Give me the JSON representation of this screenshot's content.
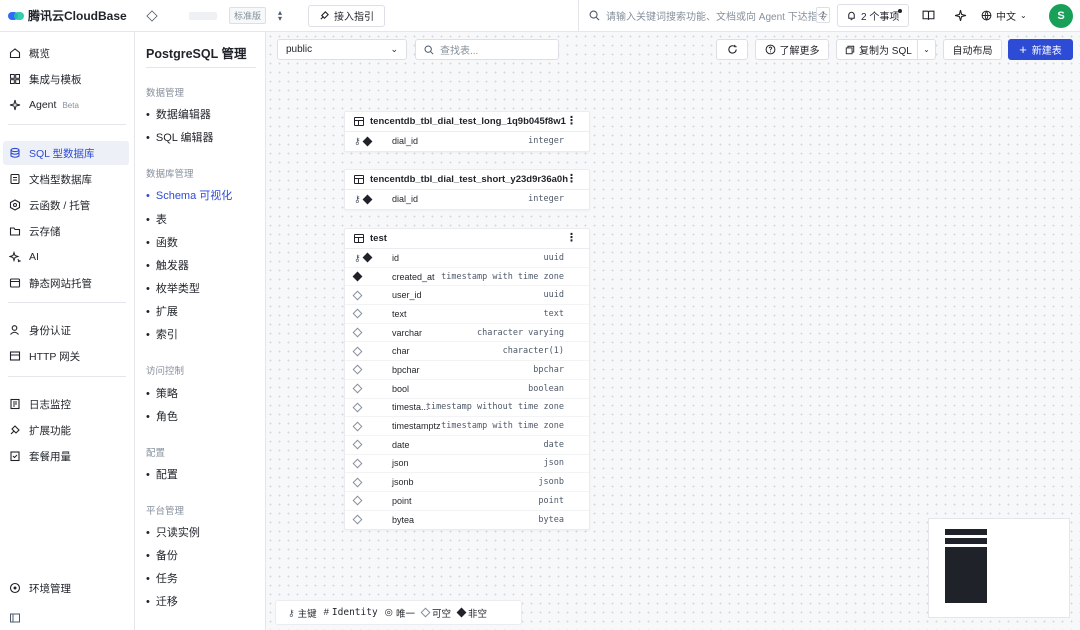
{
  "topbar": {
    "logo_text": "腾讯云CloudBase",
    "edition": "标准版",
    "guide_label": "接入指引",
    "search_placeholder": "请输入关键词搜索功能、文档或向 Agent 下达指令",
    "search_shortcut": "/",
    "todo_label": "2 个事项",
    "language": "中文",
    "avatar_letter": "S"
  },
  "leftnav": {
    "items": [
      {
        "label": "概览",
        "icon": "home-icon"
      },
      {
        "label": "集成与模板",
        "icon": "grid-icon"
      },
      {
        "label": "Agent",
        "icon": "sparkle-icon",
        "badge": "Beta"
      },
      {
        "label": "SQL 型数据库",
        "icon": "database-icon",
        "active": true
      },
      {
        "label": "文档型数据库",
        "icon": "document-db-icon"
      },
      {
        "label": "云函数 / 托管",
        "icon": "function-icon"
      },
      {
        "label": "云存储",
        "icon": "folder-icon"
      },
      {
        "label": "AI",
        "icon": "ai-icon"
      },
      {
        "label": "静态网站托管",
        "icon": "website-icon"
      },
      {
        "label": "身份认证",
        "icon": "user-icon"
      },
      {
        "label": "HTTP 网关",
        "icon": "gateway-icon"
      },
      {
        "label": "日志监控",
        "icon": "monitor-icon"
      },
      {
        "label": "扩展功能",
        "icon": "extension-icon"
      },
      {
        "label": "套餐用量",
        "icon": "package-icon"
      },
      {
        "label": "环境管理",
        "icon": "settings-icon"
      }
    ]
  },
  "subnav": {
    "title": "PostgreSQL 管理",
    "sections": [
      {
        "title": "数据管理",
        "items": [
          "数据编辑器",
          "SQL 编辑器"
        ]
      },
      {
        "title": "数据库管理",
        "items": [
          "Schema 可视化",
          "表",
          "函数",
          "触发器",
          "枚举类型",
          "扩展",
          "索引"
        ]
      },
      {
        "title": "访问控制",
        "items": [
          "策略",
          "角色"
        ]
      },
      {
        "title": "配置",
        "items": [
          "配置"
        ]
      },
      {
        "title": "平台管理",
        "items": [
          "只读实例",
          "备份",
          "任务",
          "迁移"
        ]
      }
    ],
    "active_item": "Schema 可视化"
  },
  "toolbar": {
    "schema_value": "public",
    "table_search_placeholder": "查找表...",
    "learn_more": "了解更多",
    "copy_sql": "复制为 SQL",
    "auto_layout": "自动布局",
    "new_table": "新建表"
  },
  "tables": [
    {
      "name": "tencentdb_tbl_dial_test_long_1q9b045f8w1",
      "columns": [
        {
          "name": "dial_id",
          "type": "integer",
          "pk": true,
          "notnull": true
        }
      ]
    },
    {
      "name": "tencentdb_tbl_dial_test_short_y23d9r36a0h",
      "columns": [
        {
          "name": "dial_id",
          "type": "integer",
          "pk": true,
          "notnull": true
        }
      ]
    },
    {
      "name": "test",
      "columns": [
        {
          "name": "id",
          "type": "uuid",
          "pk": true,
          "notnull": true
        },
        {
          "name": "created_at",
          "type": "timestamp with time zone",
          "pk": false,
          "notnull": true
        },
        {
          "name": "user_id",
          "type": "uuid",
          "pk": false,
          "notnull": false
        },
        {
          "name": "text",
          "type": "text",
          "pk": false,
          "notnull": false
        },
        {
          "name": "varchar",
          "type": "character varying",
          "pk": false,
          "notnull": false
        },
        {
          "name": "char",
          "type": "character(1)",
          "pk": false,
          "notnull": false
        },
        {
          "name": "bpchar",
          "type": "bpchar",
          "pk": false,
          "notnull": false
        },
        {
          "name": "bool",
          "type": "boolean",
          "pk": false,
          "notnull": false
        },
        {
          "name": "timesta...",
          "type": "timestamp without time zone",
          "pk": false,
          "notnull": false
        },
        {
          "name": "timestamptz",
          "type": "timestamp with time zone",
          "pk": false,
          "notnull": false
        },
        {
          "name": "date",
          "type": "date",
          "pk": false,
          "notnull": false
        },
        {
          "name": "json",
          "type": "json",
          "pk": false,
          "notnull": false
        },
        {
          "name": "jsonb",
          "type": "jsonb",
          "pk": false,
          "notnull": false
        },
        {
          "name": "point",
          "type": "point",
          "pk": false,
          "notnull": false
        },
        {
          "name": "bytea",
          "type": "bytea",
          "pk": false,
          "notnull": false
        }
      ]
    }
  ],
  "legend": {
    "primary_key": "主键",
    "identity": "Identity",
    "unique": "唯一",
    "nullable": "可空",
    "not_null": "非空"
  },
  "colors": {
    "accent": "#2e4bd6",
    "avatar": "#18a058"
  }
}
